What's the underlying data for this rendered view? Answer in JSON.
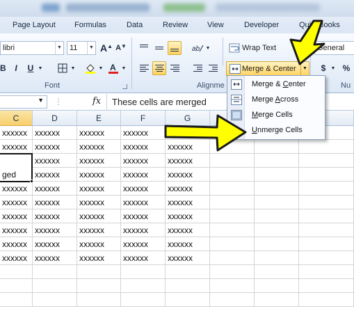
{
  "window": {},
  "tabs": [
    {
      "label": "Page Layout"
    },
    {
      "label": "Formulas"
    },
    {
      "label": "Data"
    },
    {
      "label": "Review"
    },
    {
      "label": "View"
    },
    {
      "label": "Developer"
    },
    {
      "label": "QuickBooks"
    }
  ],
  "ribbon": {
    "font_name": "libri",
    "font_size": "11",
    "grow_font": "A",
    "shrink_font": "A",
    "bold": "B",
    "italic": "I",
    "underline": "U",
    "font_group": "Font",
    "alignment_group": "Alignme",
    "number_group": "Nu",
    "wrap_text": "Wrap Text",
    "merge_center": "Merge & Center",
    "number_format": "General",
    "currency": "$",
    "percent": "%"
  },
  "formula_bar": {
    "fx": "fx",
    "value": "These cells are merged"
  },
  "columns": [
    "C",
    "D",
    "E",
    "F",
    "G"
  ],
  "rows": [
    [
      "xxxxxx",
      "xxxxxx",
      "xxxxxx",
      "xxxxxx",
      ""
    ],
    [
      "xxxxxx",
      "xxxxxx",
      "xxxxxx",
      "xxxxxx",
      "xxxxxx"
    ],
    [
      "",
      "xxxxxx",
      "xxxxxx",
      "xxxxxx",
      "xxxxxx"
    ],
    [
      "ged",
      "xxxxxx",
      "xxxxxx",
      "xxxxxx",
      "xxxxxx"
    ],
    [
      "xxxxxx",
      "xxxxxx",
      "xxxxxx",
      "xxxxxx",
      "xxxxxx"
    ],
    [
      "xxxxxx",
      "xxxxxx",
      "xxxxxx",
      "xxxxxx",
      "xxxxxx"
    ],
    [
      "xxxxxx",
      "xxxxxx",
      "xxxxxx",
      "xxxxxx",
      "xxxxxx"
    ],
    [
      "xxxxxx",
      "xxxxxx",
      "xxxxxx",
      "xxxxxx",
      "xxxxxx"
    ],
    [
      "xxxxxx",
      "xxxxxx",
      "xxxxxx",
      "xxxxxx",
      "xxxxxx"
    ],
    [
      "xxxxxx",
      "xxxxxx",
      "xxxxxx",
      "xxxxxx",
      "xxxxxx"
    ],
    [
      "",
      "",
      "",
      "",
      ""
    ],
    [
      "",
      "",
      "",
      "",
      ""
    ],
    [
      "",
      "",
      "",
      "",
      ""
    ]
  ],
  "menu": {
    "items": [
      {
        "pre": "Merge & ",
        "u": "C",
        "post": "enter",
        "icon": "merge-center-icon"
      },
      {
        "pre": "Merge ",
        "u": "A",
        "post": "cross",
        "icon": "merge-across-icon"
      },
      {
        "pre": "",
        "u": "M",
        "post": "erge Cells",
        "icon": "merge-cells-icon"
      },
      {
        "pre": "",
        "u": "U",
        "post": "nmerge Cells",
        "icon": "unmerge-cells-icon"
      }
    ]
  },
  "colors": {
    "ribbon_blue": "#dde8f6",
    "highlight": "#ffd35f",
    "arrow_yellow": "#ffff00",
    "menu_border": "#8aa0c0"
  }
}
